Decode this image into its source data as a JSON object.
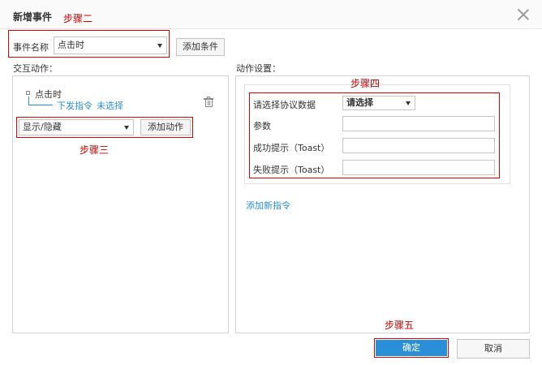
{
  "dialog": {
    "title": "新增事件"
  },
  "annotations": {
    "step2": "步骤二",
    "step3": "步骤三",
    "step4": "步骤四",
    "step5": "步骤五"
  },
  "event_row": {
    "label": "事件名称",
    "select_value": "点击时",
    "add_condition": "添加条件"
  },
  "left_panel": {
    "heading": "交互动作：",
    "tree_root": "点击时",
    "tree_child_action": "下发指令",
    "tree_child_target": "未选择",
    "action_select_value": "显示/隐藏",
    "add_action": "添加动作"
  },
  "right_panel": {
    "heading": "动作设置：",
    "protocol_label": "请选择协议数据",
    "protocol_value": "请选择",
    "param_label": "参数",
    "success_label": "成功提示（Toast）",
    "fail_label": "失败提示（Toast）",
    "add_command": "添加新指令"
  },
  "footer": {
    "confirm": "确定",
    "cancel": "取消"
  },
  "colors": {
    "annotation_red": "#e00000",
    "primary": "#2b8fd8",
    "link": "#2b8fd8"
  }
}
